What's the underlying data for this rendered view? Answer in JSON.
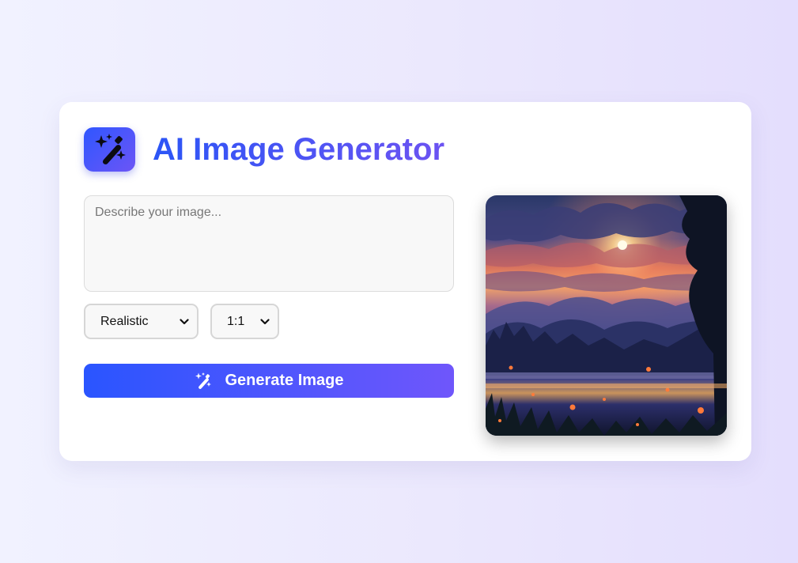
{
  "header": {
    "title": "AI Image Generator",
    "logo_icon": "magic-wand-icon"
  },
  "prompt": {
    "placeholder": "Describe your image...",
    "value": ""
  },
  "style_select": {
    "selected": "Realistic"
  },
  "ratio_select": {
    "selected": "1:1"
  },
  "generate_button": {
    "label": "Generate Image",
    "icon": "magic-wand-icon"
  },
  "preview": {
    "alt": "generated image preview"
  },
  "colors": {
    "accent_start": "#2a55ff",
    "accent_end": "#6f56fb",
    "background": "#ebe8fd"
  }
}
